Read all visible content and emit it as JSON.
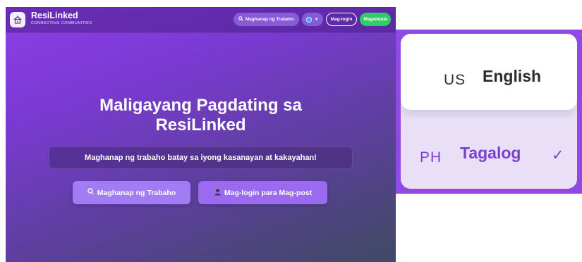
{
  "navbar": {
    "logo_icon": "house-icon",
    "brand_name": "ResiLinked",
    "brand_tagline": "CONNECTING COMMUNITIES",
    "search_jobs_label": "Maghanap ng Trabaho",
    "search_icon": "magnifier-icon",
    "language_icon": "globe-icon",
    "login_label": "Mag-login",
    "start_label": "Magsimula"
  },
  "hero": {
    "title_line1": "Maligayang Pagdating sa",
    "title_line2": "ResiLinked",
    "subtitle": "Maghanap ng trabaho batay sa iyong kasanayan at kakayahan!",
    "find_jobs_button": "Maghanap ng Trabaho",
    "login_post_button": "Mag-login para Mag-post",
    "login_post_icon": "person-icon"
  },
  "language_menu": {
    "options": [
      {
        "code": "US",
        "label": "English",
        "selected": false
      },
      {
        "code": "PH",
        "label": "Tagalog",
        "selected": true
      }
    ],
    "selected_mark": "✓"
  },
  "colors": {
    "accent": "#8d3fe6",
    "start_button": "#2fcf67",
    "selected_text": "#7b3fd6"
  }
}
